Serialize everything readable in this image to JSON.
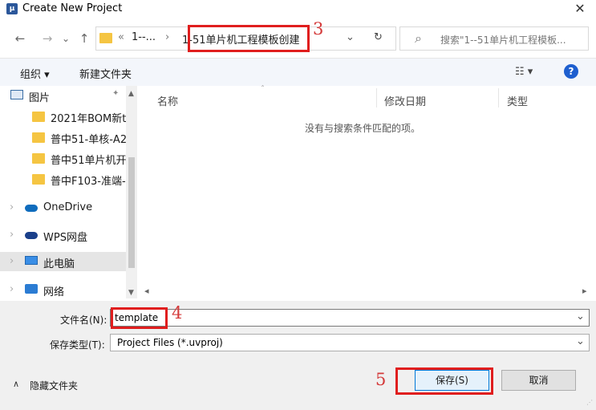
{
  "window": {
    "title": "Create New Project",
    "close_glyph": "✕"
  },
  "nav": {
    "back_glyph": "←",
    "forward_glyph": "→",
    "recent_glyph": "⌄",
    "up_glyph": "↑",
    "overflow": "«",
    "crumbs": [
      "1--...",
      "1-51单片机工程模板创建"
    ],
    "crumb_sep": "›",
    "dropdown_glyph": "⌄",
    "refresh_glyph": "↻"
  },
  "search": {
    "placeholder": "搜索\"1--51单片机工程模板...",
    "icon_glyph": "⌕"
  },
  "toolbar": {
    "organize": "组织 ▾",
    "new_folder": "新建文件夹",
    "view_glyph": "☷ ▾",
    "help_glyph": "?"
  },
  "sidebar": {
    "items": [
      {
        "label": "图片",
        "pinned": "📌",
        "kind": "pictures"
      },
      {
        "label": "2021年BOM新ti",
        "kind": "folder"
      },
      {
        "label": "普中51-单核-A2",
        "kind": "folder"
      },
      {
        "label": "普中51单片机开",
        "kind": "folder"
      },
      {
        "label": "普中F103-准端-",
        "kind": "folder"
      },
      {
        "label": "OneDrive",
        "kind": "onedrive"
      },
      {
        "label": "WPS网盘",
        "kind": "wps"
      },
      {
        "label": "此电脑",
        "kind": "pc",
        "selected": true
      },
      {
        "label": "网络",
        "kind": "network"
      }
    ]
  },
  "columns": {
    "name": "名称",
    "modified": "修改日期",
    "type": "类型"
  },
  "empty_message": "没有与搜索条件匹配的项。",
  "form": {
    "filename_label": "文件名(N):",
    "filename_value": "template",
    "filetype_label": "保存类型(T):",
    "filetype_value": "Project Files (*.uvproj)"
  },
  "footer": {
    "hide_folders": "隐藏文件夹",
    "save": "保存(S)",
    "cancel": "取消"
  },
  "annotations": {
    "n3": "3",
    "n4": "4",
    "n5": "5"
  },
  "colors": {
    "highlight": "#e01e1e",
    "accent": "#1e5fcf",
    "folder": "#f5c542"
  }
}
